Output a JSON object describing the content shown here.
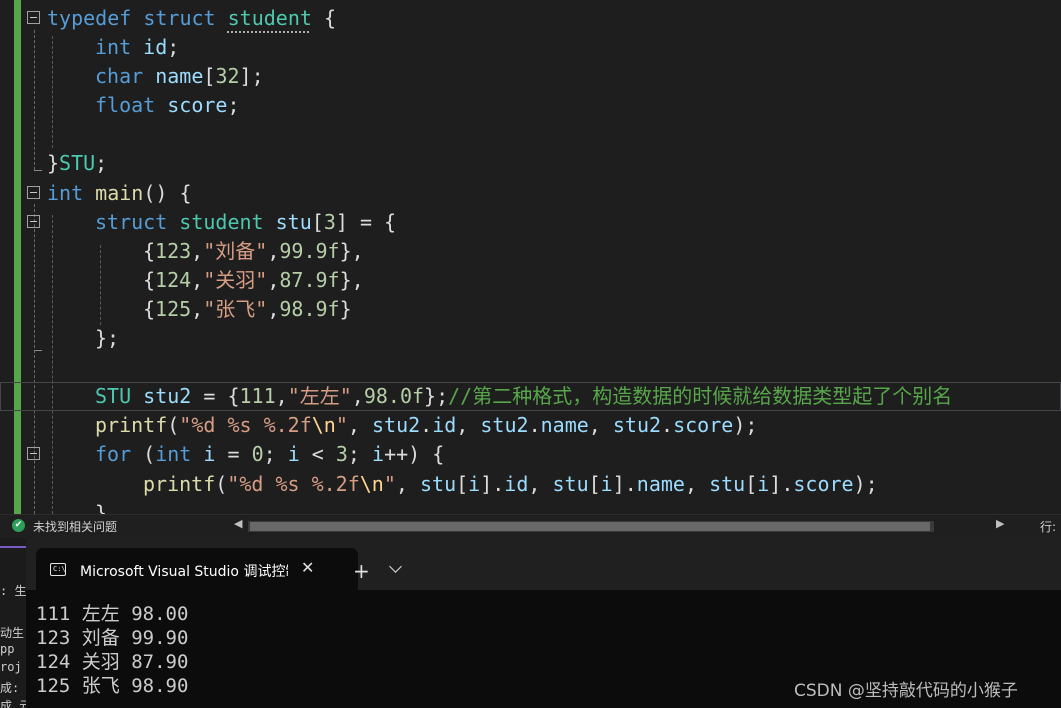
{
  "editor": {
    "code_lines": [
      [
        {
          "t": "typedef",
          "c": "k"
        },
        {
          "t": " "
        },
        {
          "t": "struct",
          "c": "k"
        },
        {
          "t": " "
        },
        {
          "t": "student",
          "c": "t sq"
        },
        {
          "t": " {"
        }
      ],
      [
        {
          "t": "int",
          "c": "k"
        },
        {
          "t": " "
        },
        {
          "t": "id",
          "c": "v"
        },
        {
          "t": ";"
        }
      ],
      [
        {
          "t": "char",
          "c": "k"
        },
        {
          "t": " "
        },
        {
          "t": "name",
          "c": "v"
        },
        {
          "t": "["
        },
        {
          "t": "32",
          "c": "n"
        },
        {
          "t": "];"
        }
      ],
      [
        {
          "t": "float",
          "c": "k"
        },
        {
          "t": " "
        },
        {
          "t": "score",
          "c": "v"
        },
        {
          "t": ";"
        }
      ],
      [],
      [
        {
          "t": "}"
        },
        {
          "t": "STU",
          "c": "t"
        },
        {
          "t": ";"
        }
      ],
      [
        {
          "t": "int",
          "c": "k"
        },
        {
          "t": " "
        },
        {
          "t": "main",
          "c": "f"
        },
        {
          "t": "() {"
        }
      ],
      [
        {
          "t": "struct",
          "c": "k"
        },
        {
          "t": " "
        },
        {
          "t": "student",
          "c": "t"
        },
        {
          "t": " "
        },
        {
          "t": "stu",
          "c": "v"
        },
        {
          "t": "["
        },
        {
          "t": "3",
          "c": "n"
        },
        {
          "t": "] = {"
        }
      ],
      [
        {
          "t": "{"
        },
        {
          "t": "123",
          "c": "n"
        },
        {
          "t": ","
        },
        {
          "t": "\"刘备\"",
          "c": "s"
        },
        {
          "t": ","
        },
        {
          "t": "99.9f",
          "c": "n"
        },
        {
          "t": "},"
        }
      ],
      [
        {
          "t": "{"
        },
        {
          "t": "124",
          "c": "n"
        },
        {
          "t": ","
        },
        {
          "t": "\"关羽\"",
          "c": "s"
        },
        {
          "t": ","
        },
        {
          "t": "87.9f",
          "c": "n"
        },
        {
          "t": "},"
        }
      ],
      [
        {
          "t": "{"
        },
        {
          "t": "125",
          "c": "n"
        },
        {
          "t": ","
        },
        {
          "t": "\"张飞\"",
          "c": "s"
        },
        {
          "t": ","
        },
        {
          "t": "98.9f",
          "c": "n"
        },
        {
          "t": "}"
        }
      ],
      [
        {
          "t": "};"
        }
      ],
      [],
      [
        {
          "t": "STU",
          "c": "t"
        },
        {
          "t": " "
        },
        {
          "t": "stu2",
          "c": "v"
        },
        {
          "t": " = {"
        },
        {
          "t": "111",
          "c": "n"
        },
        {
          "t": ","
        },
        {
          "t": "\"左左\"",
          "c": "s"
        },
        {
          "t": ","
        },
        {
          "t": "98.0f",
          "c": "n"
        },
        {
          "t": "};"
        },
        {
          "t": "//第二种格式，构造数据的时候就给数据类型起了个别名",
          "c": "c"
        }
      ],
      [
        {
          "t": "printf",
          "c": "f"
        },
        {
          "t": "("
        },
        {
          "t": "\"%d %s %.2f",
          "c": "s"
        },
        {
          "t": "\\n",
          "c": "e"
        },
        {
          "t": "\"",
          "c": "s"
        },
        {
          "t": ", "
        },
        {
          "t": "stu2",
          "c": "v"
        },
        {
          "t": "."
        },
        {
          "t": "id",
          "c": "v"
        },
        {
          "t": ", "
        },
        {
          "t": "stu2",
          "c": "v"
        },
        {
          "t": "."
        },
        {
          "t": "name",
          "c": "v"
        },
        {
          "t": ", "
        },
        {
          "t": "stu2",
          "c": "v"
        },
        {
          "t": "."
        },
        {
          "t": "score",
          "c": "v"
        },
        {
          "t": ");"
        }
      ],
      [
        {
          "t": "for",
          "c": "k"
        },
        {
          "t": " ("
        },
        {
          "t": "int",
          "c": "k"
        },
        {
          "t": " "
        },
        {
          "t": "i",
          "c": "v"
        },
        {
          "t": " = "
        },
        {
          "t": "0",
          "c": "n"
        },
        {
          "t": "; "
        },
        {
          "t": "i",
          "c": "v"
        },
        {
          "t": " < "
        },
        {
          "t": "3",
          "c": "n"
        },
        {
          "t": "; "
        },
        {
          "t": "i",
          "c": "v"
        },
        {
          "t": "++) {"
        }
      ],
      [
        {
          "t": "printf",
          "c": "f"
        },
        {
          "t": "("
        },
        {
          "t": "\"%d %s %.2f",
          "c": "s"
        },
        {
          "t": "\\n",
          "c": "e"
        },
        {
          "t": "\"",
          "c": "s"
        },
        {
          "t": ", "
        },
        {
          "t": "stu",
          "c": "v"
        },
        {
          "t": "["
        },
        {
          "t": "i",
          "c": "v"
        },
        {
          "t": "]."
        },
        {
          "t": "id",
          "c": "v"
        },
        {
          "t": ", "
        },
        {
          "t": "stu",
          "c": "v"
        },
        {
          "t": "["
        },
        {
          "t": "i",
          "c": "v"
        },
        {
          "t": "]."
        },
        {
          "t": "name",
          "c": "v"
        },
        {
          "t": ", "
        },
        {
          "t": "stu",
          "c": "v"
        },
        {
          "t": "["
        },
        {
          "t": "i",
          "c": "v"
        },
        {
          "t": "]."
        },
        {
          "t": "score",
          "c": "v"
        },
        {
          "t": ");"
        }
      ],
      [
        {
          "t": "}"
        }
      ]
    ]
  },
  "status": {
    "check_icon": "✔",
    "issues": "未找到相关问题",
    "scroll_left": "◀",
    "scroll_right": "▶",
    "row_label": "行:"
  },
  "left_panel": {
    "lines": [
      ": 生",
      "",
      "动生",
      "pp",
      "roj",
      "成:",
      "成 元"
    ]
  },
  "terminal": {
    "icon_text": "C:\\",
    "tab_title": "Microsoft Visual Studio 调试控制台",
    "close_glyph": "✕",
    "new_tab_glyph": "+",
    "output": [
      "111 左左 98.00",
      "123 刘备 99.90",
      "124 关羽 87.90",
      "125 张飞 98.90"
    ]
  },
  "watermark": "CSDN @坚持敲代码的小猴子"
}
